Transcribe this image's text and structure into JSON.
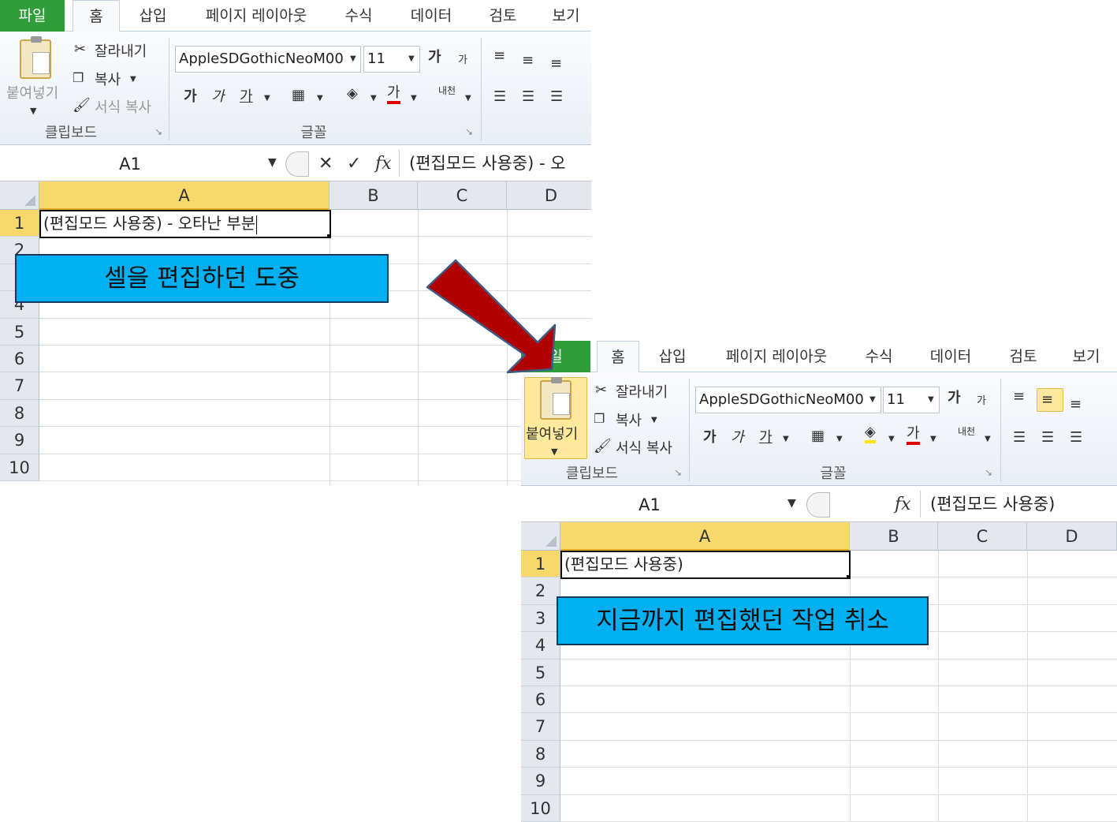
{
  "ribbon": {
    "tabs": [
      "파일",
      "홈",
      "삽입",
      "페이지 레이아웃",
      "수식",
      "데이터",
      "검토",
      "보기"
    ],
    "clipboard": {
      "paste_label": "붙여넣기",
      "cut_label": "잘라내기",
      "copy_label": "복사",
      "format_painter_label": "서식 복사",
      "group_label": "클립보드"
    },
    "font": {
      "font_name": "AppleSDGothicNeoM00",
      "font_size": "11",
      "bold": "가",
      "italic": "가",
      "underline": "가",
      "font_color": "가",
      "grow": "가",
      "shrink": "가",
      "phonetic": "내천",
      "group_label": "글꼴"
    },
    "colors": {
      "file_tab": "#2f9e3a",
      "font_color_bar": "#e00000",
      "fill_color_bar": "#ffe600",
      "align_highlight": "#fde89b"
    }
  },
  "formula_bar": {
    "fx": "fx",
    "cancel": "✕",
    "enter": "✓"
  },
  "sheet": {
    "columns": [
      "A",
      "B",
      "C",
      "D"
    ],
    "rows": [
      "1",
      "2",
      "3",
      "4",
      "5",
      "6",
      "7",
      "8",
      "9",
      "10"
    ]
  },
  "before": {
    "name_box": "A1",
    "formula": "(편집모드 사용중) - 오",
    "cell_a1": "(편집모드 사용중) - 오타난 부분",
    "callout": "셀을 편집하던 도중"
  },
  "after": {
    "tab_partial": "일",
    "name_box": "A1",
    "formula": "(편집모드 사용중)",
    "cell_a1": "(편집모드 사용중)",
    "callout": "지금까지 편집했던 작업 취소"
  },
  "arrow": {
    "fill": "#b00000",
    "stroke": "#3f5a85"
  }
}
